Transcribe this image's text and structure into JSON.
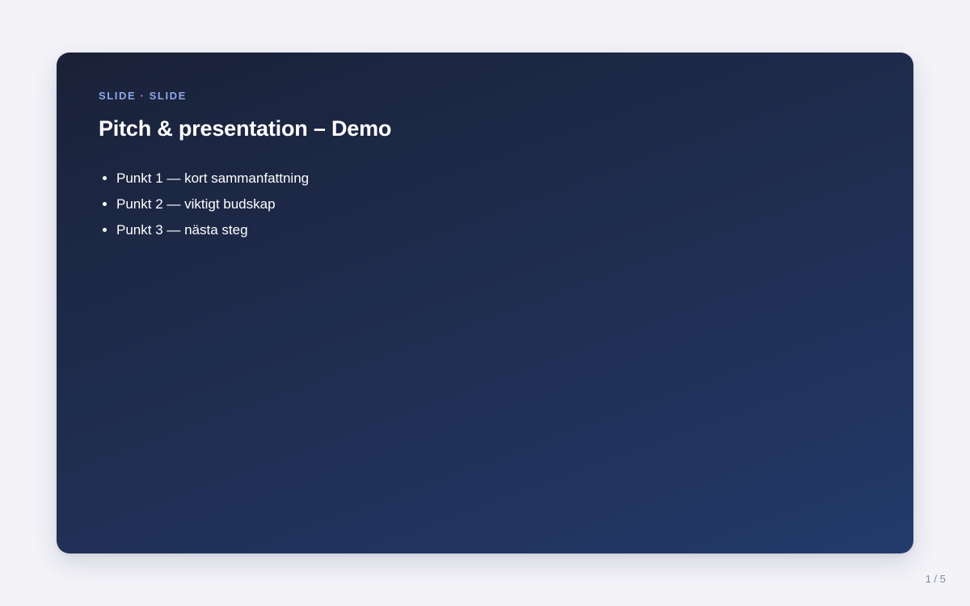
{
  "slide": {
    "kicker": "SLIDE · SLIDE",
    "title": "Pitch & presentation – Demo",
    "bullets": [
      "Punkt 1 — kort sammanfattning",
      "Punkt 2 — viktigt budskap",
      "Punkt 3 — nästa steg"
    ]
  },
  "navigation": {
    "page_indicator": "1 / 5"
  },
  "colors": {
    "page_background": "#f3f3f8",
    "slide_gradient_start": "#1a2238",
    "slide_gradient_end": "#233a6b",
    "kicker": "#8fa8e8",
    "text": "#ffffff",
    "counter": "#8088a8"
  }
}
